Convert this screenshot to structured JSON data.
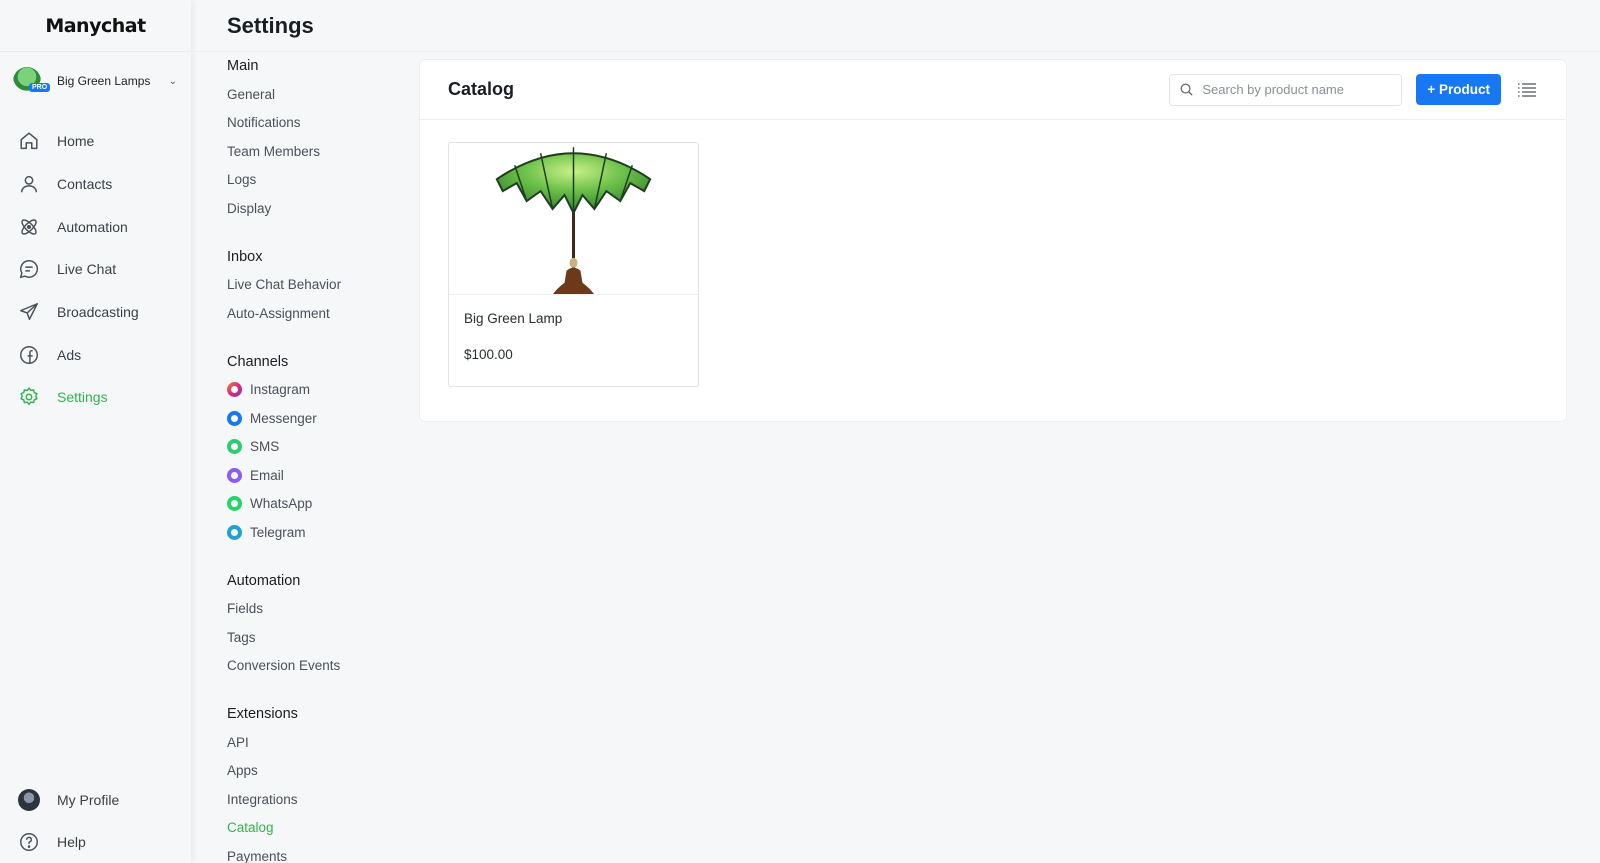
{
  "app": {
    "logo": "Manychat"
  },
  "account": {
    "name": "Big Green Lamps",
    "badge": "PRO"
  },
  "nav": {
    "items": [
      {
        "label": "Home",
        "icon": "home-icon"
      },
      {
        "label": "Contacts",
        "icon": "user-icon"
      },
      {
        "label": "Automation",
        "icon": "automation-icon"
      },
      {
        "label": "Live Chat",
        "icon": "chat-bubble-icon"
      },
      {
        "label": "Broadcasting",
        "icon": "send-icon"
      },
      {
        "label": "Ads",
        "icon": "facebook-icon"
      },
      {
        "label": "Settings",
        "icon": "gear-icon",
        "active": true
      }
    ],
    "bottom": [
      {
        "label": "My Profile",
        "icon": "avatar"
      },
      {
        "label": "Help",
        "icon": "help-icon"
      }
    ]
  },
  "page": {
    "title": "Settings"
  },
  "settings_menu": {
    "main": {
      "title": "Main",
      "items": [
        "General",
        "Notifications",
        "Team Members",
        "Logs",
        "Display"
      ]
    },
    "inbox": {
      "title": "Inbox",
      "items": [
        "Live Chat Behavior",
        "Auto-Assignment"
      ]
    },
    "channels": {
      "title": "Channels",
      "items": [
        {
          "label": "Instagram",
          "color": "#e1306c"
        },
        {
          "label": "Messenger",
          "color": "#1877f2"
        },
        {
          "label": "SMS",
          "color": "#2ecc71"
        },
        {
          "label": "Email",
          "color": "#8b5cf6"
        },
        {
          "label": "WhatsApp",
          "color": "#25d366"
        },
        {
          "label": "Telegram",
          "color": "#229ed9"
        }
      ]
    },
    "automation": {
      "title": "Automation",
      "items": [
        "Fields",
        "Tags",
        "Conversion Events"
      ]
    },
    "extensions": {
      "title": "Extensions",
      "items": [
        "API",
        "Apps",
        "Integrations",
        "Catalog",
        "Payments"
      ],
      "active": "Catalog"
    }
  },
  "catalog": {
    "title": "Catalog",
    "search_placeholder": "Search by product name",
    "add_button": "+ Product",
    "products": [
      {
        "name": "Big Green Lamp",
        "price": "$100.00"
      }
    ]
  },
  "colors": {
    "accent_green": "#2fb54d",
    "primary_blue": "#1877f2"
  }
}
